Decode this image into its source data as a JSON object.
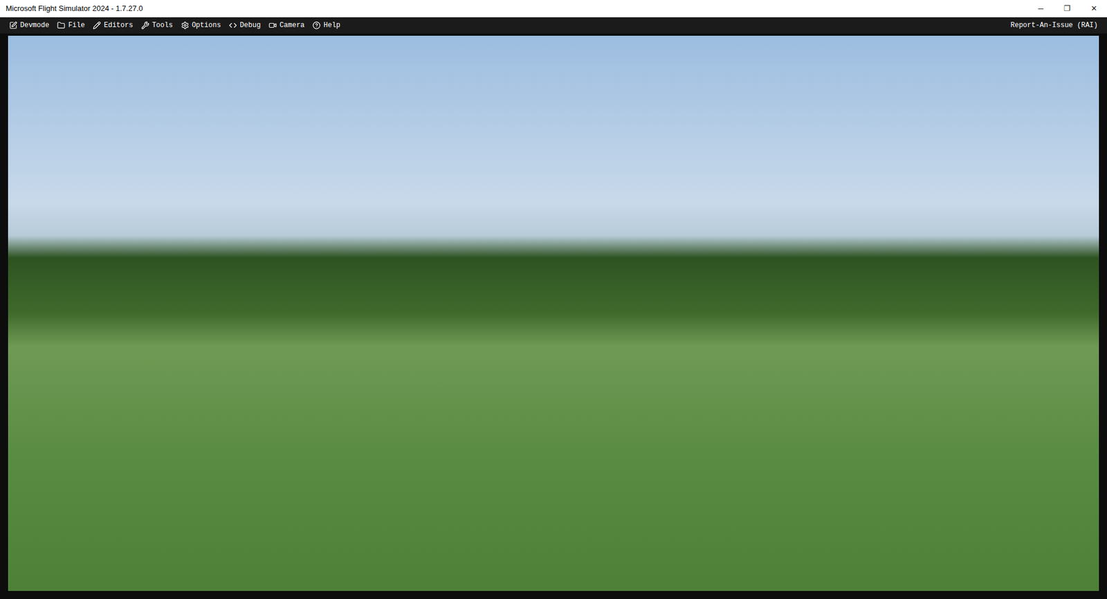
{
  "window": {
    "title": "Microsoft Flight Simulator 2024 - 1.7.27.0",
    "controls": [
      "─",
      "❐",
      "✕"
    ]
  },
  "toolbar": {
    "items": [
      "Devmode",
      "File",
      "Editors",
      "Tools",
      "Options",
      "Debug",
      "Camera",
      "Help"
    ],
    "right": "Report-An-Issue (RAI)"
  }
}
